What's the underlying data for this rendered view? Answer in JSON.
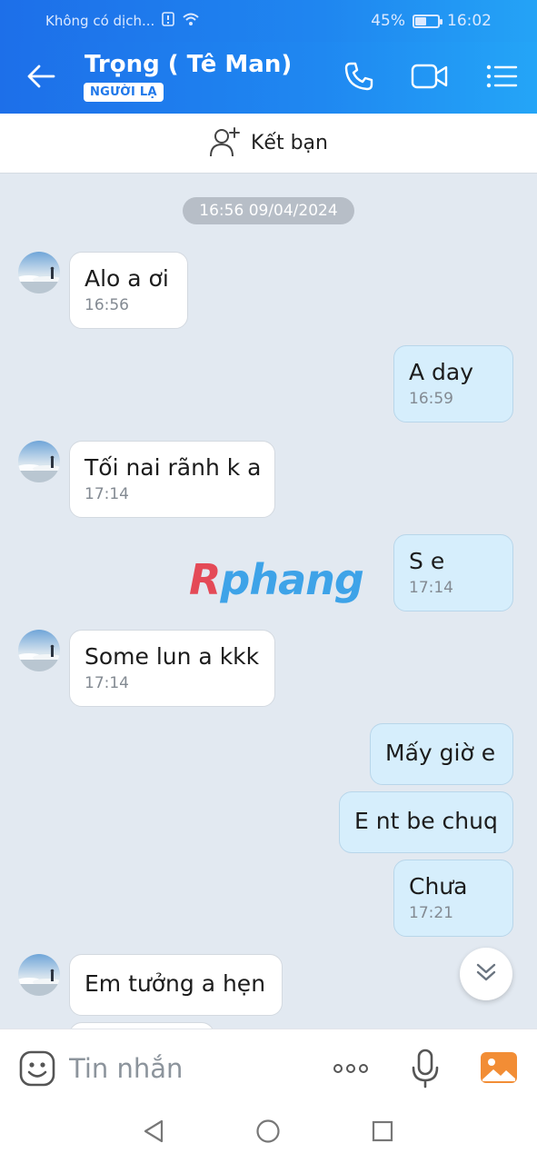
{
  "status_bar": {
    "carrier": "Không có dịch...",
    "battery_text": "45%",
    "battery_level": 0.45,
    "clock": "16:02"
  },
  "header": {
    "title": "Trọng ( Tê Man)",
    "badge": "NGƯỜI LẠ",
    "back_icon": "back-arrow-icon",
    "call_icon": "phone-icon",
    "video_icon": "video-camera-icon",
    "menu_icon": "list-menu-icon"
  },
  "add_friend": {
    "label": "Kết bạn",
    "icon": "add-person-icon"
  },
  "chat": {
    "date_separator": "16:56 09/04/2024",
    "messages": [
      {
        "dir": "in",
        "text": "Alo a ơi",
        "time": "16:56"
      },
      {
        "dir": "out",
        "text": "A day",
        "time": "16:59"
      },
      {
        "dir": "in",
        "text": "Tối nai rãnh k a",
        "time": "17:14"
      },
      {
        "dir": "out",
        "text": "S e",
        "time": "17:14"
      },
      {
        "dir": "in",
        "text": "Some lun a kkk",
        "time": "17:14"
      },
      {
        "dir": "out",
        "text": "Mấy giờ e",
        "time": ""
      },
      {
        "dir": "out",
        "text": "E nt be chuq",
        "time": ""
      },
      {
        "dir": "out",
        "text": "Chưa",
        "time": "17:21"
      },
      {
        "dir": "in",
        "text": "Em tưởng a hẹn",
        "time": ""
      }
    ],
    "watermark": {
      "first": "R",
      "rest": "phang"
    }
  },
  "input_bar": {
    "placeholder": "Tin nhắn",
    "emoji_icon": "sticker-smile-icon",
    "more_icon": "more-dots-icon",
    "mic_icon": "microphone-icon",
    "image_icon": "image-gallery-icon"
  },
  "nav_bar": {
    "back": "nav-back-icon",
    "home": "nav-home-icon",
    "recents": "nav-recents-icon"
  },
  "colors": {
    "header": "#1f88f1",
    "bubble_in": "#ffffff",
    "bubble_out": "#d6eefc",
    "background": "#e2e9f1",
    "image_button": "#f28d35"
  }
}
